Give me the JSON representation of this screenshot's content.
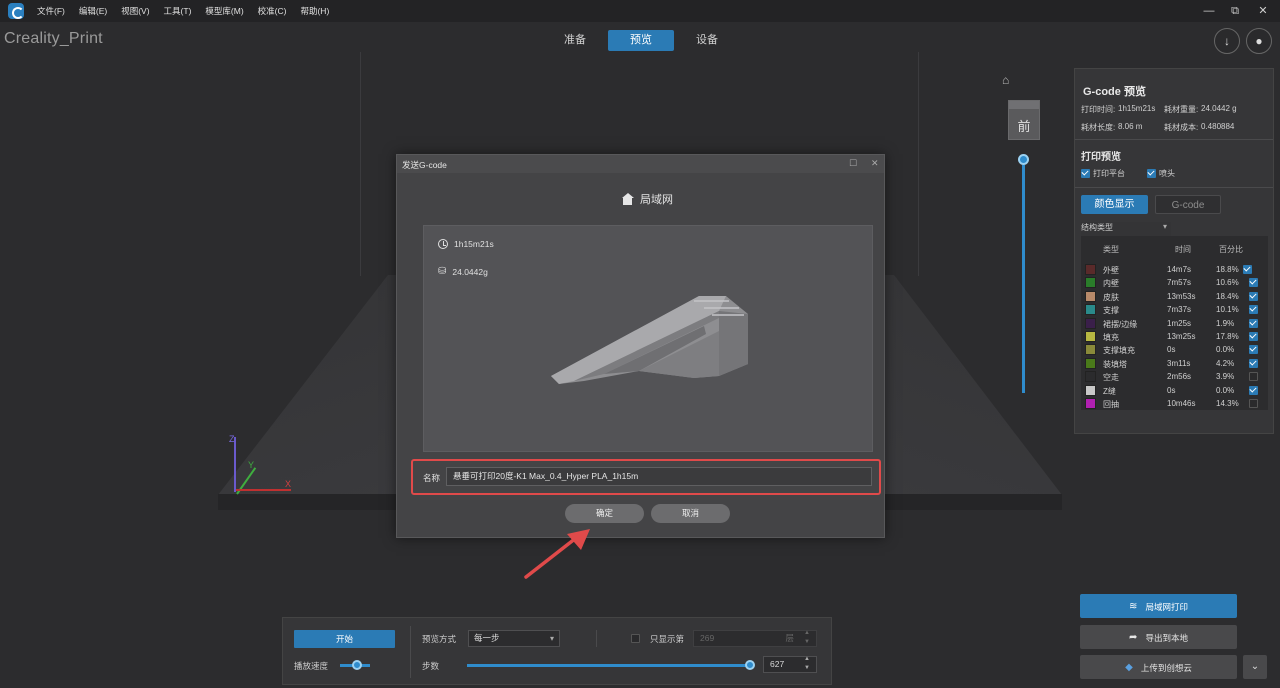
{
  "menu": [
    "文件(F)",
    "编辑(E)",
    "视图(V)",
    "工具(T)",
    "模型库(M)",
    "校准(C)",
    "帮助(H)"
  ],
  "window_controls": {
    "minimize": "—",
    "maximize": "⧉",
    "close": "✕"
  },
  "brand": "Creality_Print",
  "tabs": [
    {
      "label": "准备",
      "active": false
    },
    {
      "label": "预览",
      "active": true
    },
    {
      "label": "设备",
      "active": false
    }
  ],
  "view_cube_label": "前",
  "axes": {
    "z": "Z",
    "y": "Y",
    "x": "X"
  },
  "gcode_panel": {
    "title": "G-code 预览",
    "print_time_label": "打印时间:",
    "print_time": "1h15m21s",
    "weight_label": "耗材重量:",
    "weight": "24.0442 g",
    "length_label": "耗材长度:",
    "length": "8.06 m",
    "cost_label": "耗材成本:",
    "cost": "0.480884",
    "preview_section": "打印预览",
    "show_plate": "打印平台",
    "show_nozzle": "喷头",
    "color_display": "颜色显示",
    "gcode_tab": "G-code",
    "structure_dropdown": "结构类型",
    "columns": [
      "类型",
      "时间",
      "百分比"
    ],
    "rows": [
      {
        "color": "#5a2a2a",
        "name": "外壁",
        "time": "14m7s",
        "percent": "18.8%",
        "checked": true
      },
      {
        "color": "#2a7d2a",
        "name": "内壁",
        "time": "7m57s",
        "percent": "10.6%",
        "checked": true
      },
      {
        "color": "#b88a6a",
        "name": "皮肤",
        "time": "13m53s",
        "percent": "18.4%",
        "checked": true
      },
      {
        "color": "#2a8a8a",
        "name": "支撑",
        "time": "7m37s",
        "percent": "10.1%",
        "checked": true
      },
      {
        "color": "#3a1f4a",
        "name": "裙摆/边缘",
        "time": "1m25s",
        "percent": "1.9%",
        "checked": true
      },
      {
        "color": "#b8b842",
        "name": "填充",
        "time": "13m25s",
        "percent": "17.8%",
        "checked": true
      },
      {
        "color": "#8a8a3a",
        "name": "支撑填充",
        "time": "0s",
        "percent": "0.0%",
        "checked": true
      },
      {
        "color": "#4a7a1a",
        "name": "装填塔",
        "time": "3m11s",
        "percent": "4.2%",
        "checked": true
      },
      {
        "color": "#2b2b2d",
        "name": "空走",
        "time": "2m56s",
        "percent": "3.9%",
        "checked": false
      },
      {
        "color": "#c8c8c8",
        "name": "Z缝",
        "time": "0s",
        "percent": "0.0%",
        "checked": true
      },
      {
        "color": "#b020b0",
        "name": "回抽",
        "time": "10m46s",
        "percent": "14.3%",
        "checked": false
      }
    ]
  },
  "dialog": {
    "title": "发送G-code",
    "maximize": "☐",
    "close": "✕",
    "target": "局域网",
    "time": "1h15m21s",
    "weight": "24.0442g",
    "name_label": "名称",
    "name_value": "悬垂可打印20度-K1 Max_0.4_Hyper PLA_1h15m",
    "confirm": "确定",
    "cancel": "取消"
  },
  "bottom_bar": {
    "start": "开始",
    "speed_label": "播放速度",
    "speed_level": 0.55,
    "mode_label": "预览方式",
    "mode_value": "每一步",
    "only_show_label": "只显示第",
    "layer_value": "269",
    "layer_unit": "层",
    "steps_label": "步数",
    "steps_value": "627",
    "steps_level": 1.0
  },
  "right_buttons": {
    "lan_print": "局域网打印",
    "export_local": "导出到本地",
    "upload_cloud": "上传到创想云",
    "more": "⌄"
  },
  "colors": {
    "accent": "#2b7bb5",
    "highlight": "#e04a4a"
  }
}
